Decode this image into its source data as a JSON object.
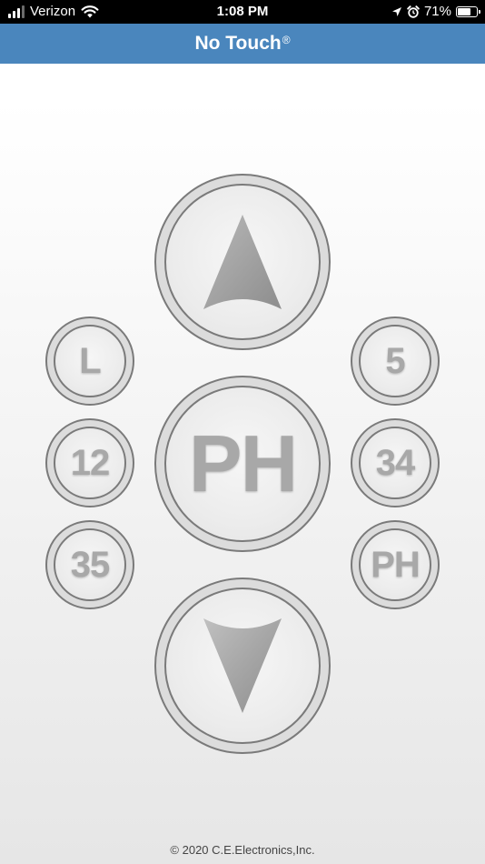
{
  "status_bar": {
    "carrier": "Verizon",
    "time": "1:08 PM",
    "battery": "71%",
    "battery_level": 0.71,
    "icons": [
      "signal-icon",
      "wifi-icon",
      "location-arrow-icon",
      "alarm-icon",
      "battery-icon"
    ]
  },
  "header": {
    "title": "No Touch",
    "registered_mark": "®"
  },
  "controls": {
    "up_icon": "up-arrow-icon",
    "down_icon": "down-arrow-icon",
    "center_label": "PH",
    "left_buttons": [
      {
        "label": "L"
      },
      {
        "label": "12"
      },
      {
        "label": "35"
      }
    ],
    "right_buttons": [
      {
        "label": "5"
      },
      {
        "label": "34"
      },
      {
        "label": "PH"
      }
    ]
  },
  "footer": {
    "copyright": "© 2020 C.E.Electronics,Inc."
  },
  "colors": {
    "header_bg": "#4a86bd",
    "button_label": "#a8a8a8",
    "button_border": "#7a7a7a"
  }
}
